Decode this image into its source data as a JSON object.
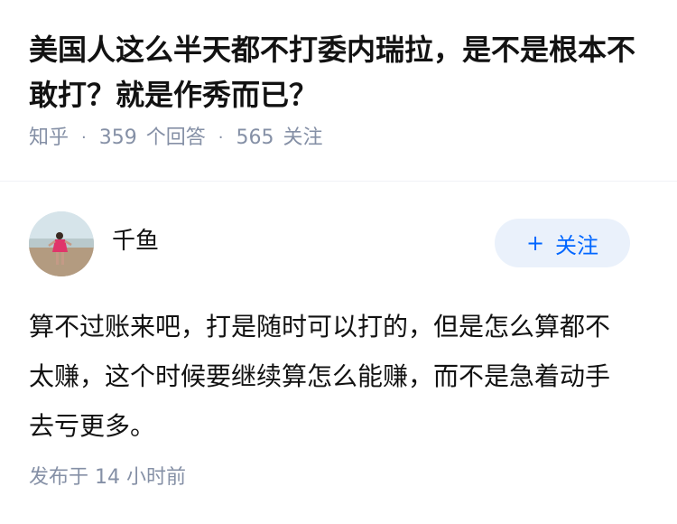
{
  "question": {
    "title": "美国人这么半天都不打委内瑞拉，是不是根本不敢打？就是作秀而已？",
    "source": "知乎",
    "answer_count": "359",
    "answer_label": "个回答",
    "follower_count": "565",
    "follower_label": "关注"
  },
  "answer": {
    "author": {
      "name": "千鱼",
      "avatar_icon": "avatar-child-on-beach"
    },
    "follow_button": {
      "icon": "plus-icon",
      "label": "关注"
    },
    "content": "算不过账来吧，打是随时可以打的，但是怎么算都不太赚，这个时候要继续算怎么能赚，而不是急着动手去亏更多。",
    "published_label": "发布于",
    "published_time": "14 小时前"
  },
  "colors": {
    "text_primary": "#121212",
    "text_secondary": "#8590a6",
    "accent": "#0066ff",
    "button_bg": "#eaf1fb"
  }
}
